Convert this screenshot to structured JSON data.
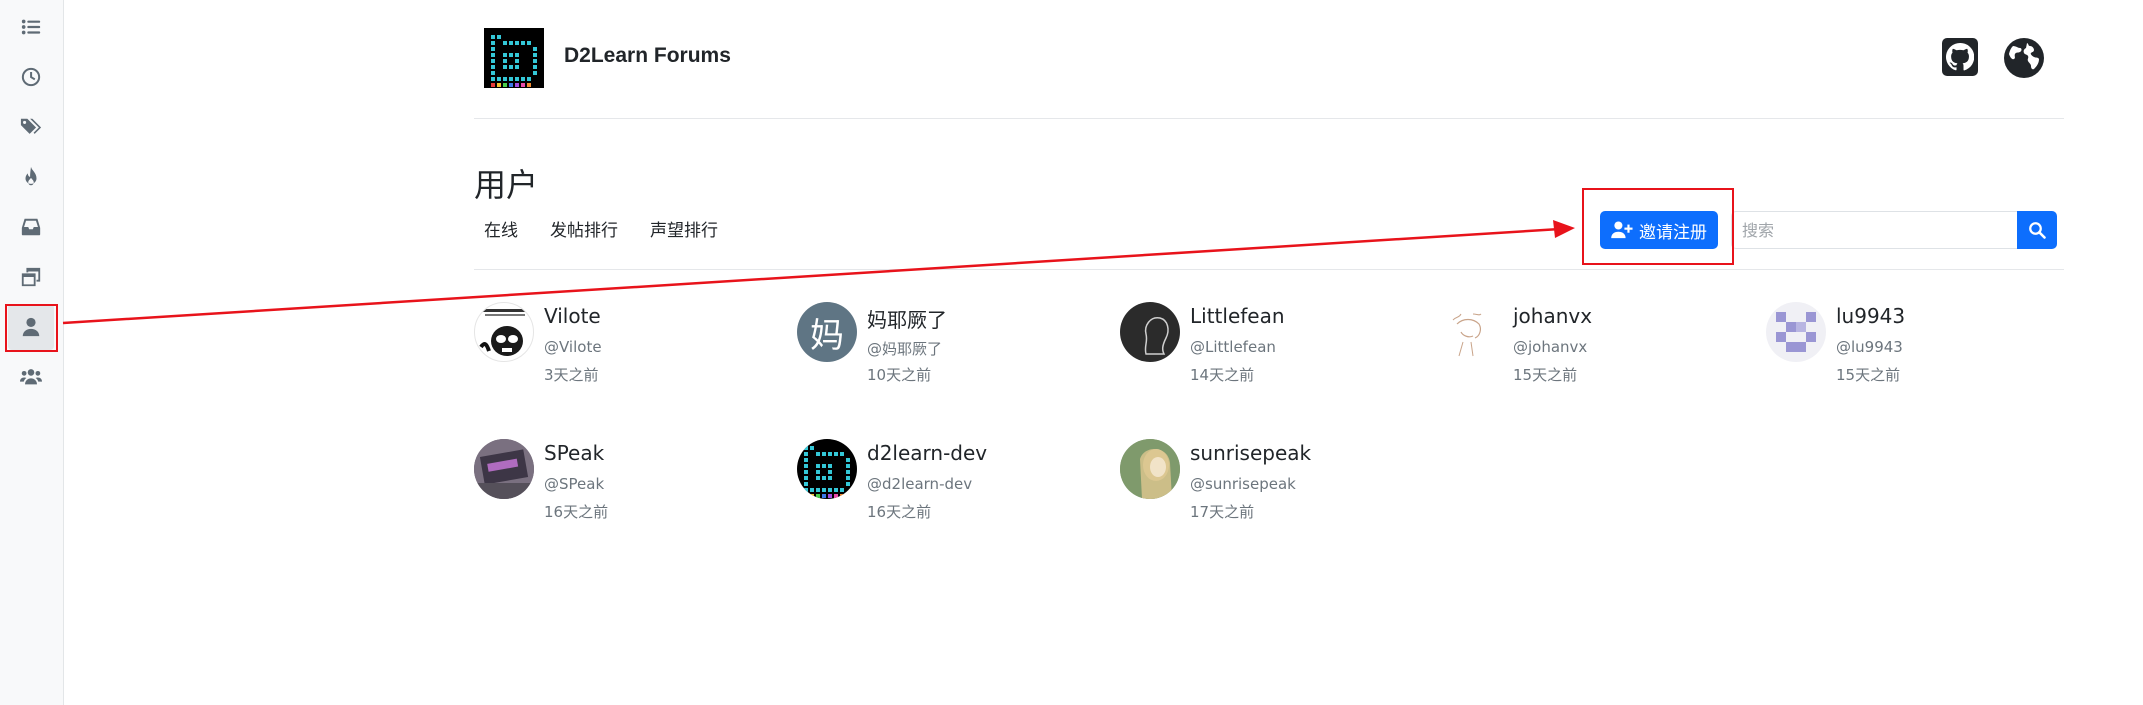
{
  "sidebar": {
    "items": [
      {
        "icon": "list-icon"
      },
      {
        "icon": "clock-icon"
      },
      {
        "icon": "tags-icon"
      },
      {
        "icon": "fire-icon"
      },
      {
        "icon": "inbox-icon"
      },
      {
        "icon": "window-restore-icon"
      },
      {
        "icon": "user-icon",
        "active": true
      },
      {
        "icon": "users-icon"
      }
    ]
  },
  "header": {
    "site_name": "D2Learn Forums",
    "github_icon": "github-icon",
    "globe_icon": "globe-icon"
  },
  "page": {
    "title": "用户",
    "tabs": [
      "在线",
      "发帖排行",
      "声望排行"
    ],
    "invite_label": "邀请注册",
    "search_placeholder": "搜索"
  },
  "users": [
    {
      "name": "Vilote",
      "handle": "@Vilote",
      "time": "3天之前"
    },
    {
      "name": "妈耶厥了",
      "handle": "@妈耶厥了",
      "time": "10天之前",
      "avatar_letter": "妈"
    },
    {
      "name": "Littlefean",
      "handle": "@Littlefean",
      "time": "14天之前"
    },
    {
      "name": "johanvx",
      "handle": "@johanvx",
      "time": "15天之前"
    },
    {
      "name": "lu9943",
      "handle": "@lu9943",
      "time": "15天之前"
    },
    {
      "name": "SPeak",
      "handle": "@SPeak",
      "time": "16天之前"
    },
    {
      "name": "d2learn-dev",
      "handle": "@d2learn-dev",
      "time": "16天之前"
    },
    {
      "name": "sunrisepeak",
      "handle": "@sunrisepeak",
      "time": "17天之前"
    }
  ],
  "colors": {
    "primary": "#0d6efd",
    "annotation": "#e8131b",
    "sidebar_bg": "#f8f9fa"
  }
}
